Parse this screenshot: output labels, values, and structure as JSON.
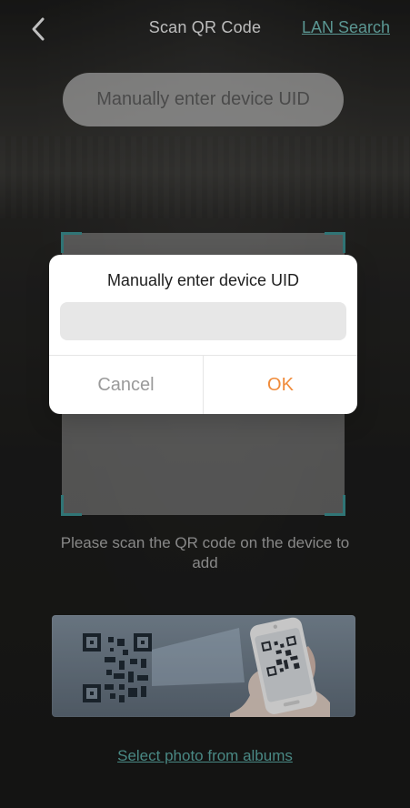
{
  "header": {
    "back_icon": "chevron-left-icon",
    "title": "Scan QR Code",
    "lan_search_label": "LAN Search"
  },
  "main": {
    "manual_enter_label": "Manually enter device UID",
    "scan_instruction": "Please scan the QR code on the device to add",
    "illustration_icon": "scan-phone-illustration",
    "select_photo_label": "Select photo from albums"
  },
  "dialog": {
    "title": "Manually enter device UID",
    "input_value": "",
    "input_placeholder": "",
    "cancel_label": "Cancel",
    "ok_label": "OK"
  },
  "colors": {
    "accent_teal": "#6fb9b4",
    "ok_orange": "#f08b3a",
    "cancel_gray": "#9a9a9a"
  }
}
